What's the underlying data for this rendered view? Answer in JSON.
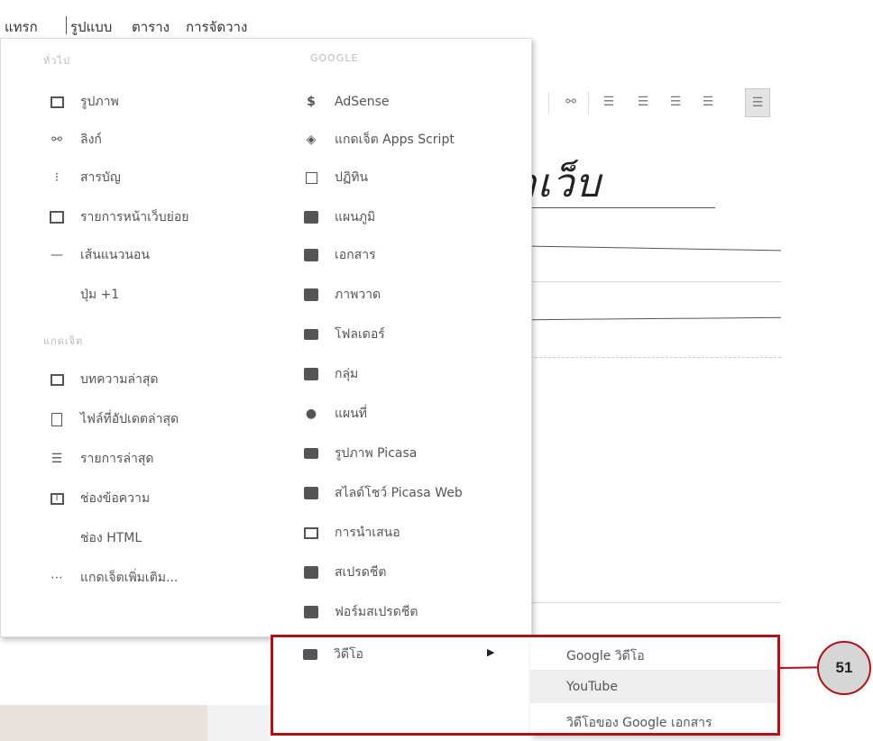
{
  "menubar": {
    "items": [
      "แทรก",
      "รูปแบบ",
      "ตาราง",
      "การจัดวาง"
    ]
  },
  "editor": {
    "page_title_fragment": "าเว็บ",
    "toolbar_icons": [
      "link-icon",
      "numbered-list-icon",
      "bulleted-list-icon",
      "indent-less-icon",
      "indent-more-icon",
      "align-icon"
    ]
  },
  "insert_menu": {
    "general_header": "ทั่วไป",
    "general_items": [
      {
        "label": "รูปภาพ",
        "icon": "image-icon"
      },
      {
        "label": "ลิงก์",
        "icon": "link-icon"
      },
      {
        "label": "สารบัญ",
        "icon": "table-of-contents-icon"
      },
      {
        "label": "รายการหน้าเว็บย่อย",
        "icon": "subpage-listing-icon"
      },
      {
        "label": "เส้นแนวนอน",
        "icon": "horizontal-line-icon"
      },
      {
        "label": "ปุ่ม +1",
        "icon": ""
      }
    ],
    "gadgets_header": "แกดเจ็ต",
    "gadget_items": [
      {
        "label": "บทความล่าสุด",
        "icon": "recent-posts-icon"
      },
      {
        "label": "ไฟล์ที่อัปเดตล่าสุด",
        "icon": "recent-files-icon"
      },
      {
        "label": "รายการล่าสุด",
        "icon": "recent-list-icon"
      },
      {
        "label": "ช่องข้อความ",
        "icon": "text-box-icon"
      },
      {
        "label": "ช่อง HTML",
        "icon": ""
      },
      {
        "label": "แกดเจ็ตเพิ่มเติม...",
        "icon": "more-gadgets-icon"
      }
    ],
    "google_header": "GOOGLE",
    "google_items": [
      {
        "label": "AdSense",
        "icon": "adsense-icon"
      },
      {
        "label": "แกดเจ็ต Apps Script",
        "icon": "apps-script-icon"
      },
      {
        "label": "ปฏิทิน",
        "icon": "calendar-icon"
      },
      {
        "label": "แผนภูมิ",
        "icon": "chart-icon"
      },
      {
        "label": "เอกสาร",
        "icon": "document-icon"
      },
      {
        "label": "ภาพวาด",
        "icon": "drawing-icon"
      },
      {
        "label": "โฟลเดอร์",
        "icon": "folder-icon"
      },
      {
        "label": "กลุ่ม",
        "icon": "groups-icon"
      },
      {
        "label": "แผนที่",
        "icon": "map-pin-icon"
      },
      {
        "label": "รูปภาพ Picasa",
        "icon": "camera-icon"
      },
      {
        "label": "สไลด์โชว์ Picasa Web",
        "icon": "slideshow-icon"
      },
      {
        "label": "การนำเสนอ",
        "icon": "presentation-icon"
      },
      {
        "label": "สเปรดชีต",
        "icon": "spreadsheet-icon"
      },
      {
        "label": "ฟอร์มสเปรดชีต",
        "icon": "form-icon"
      },
      {
        "label": "วิดีโอ",
        "icon": "video-clapper-icon"
      }
    ]
  },
  "video_submenu": {
    "items": [
      "Google วิดีโอ",
      "YouTube",
      "วิดีโอของ Google เอกสาร"
    ],
    "highlighted_index": 1
  },
  "callout": {
    "number": "51",
    "color": "#b01119"
  }
}
